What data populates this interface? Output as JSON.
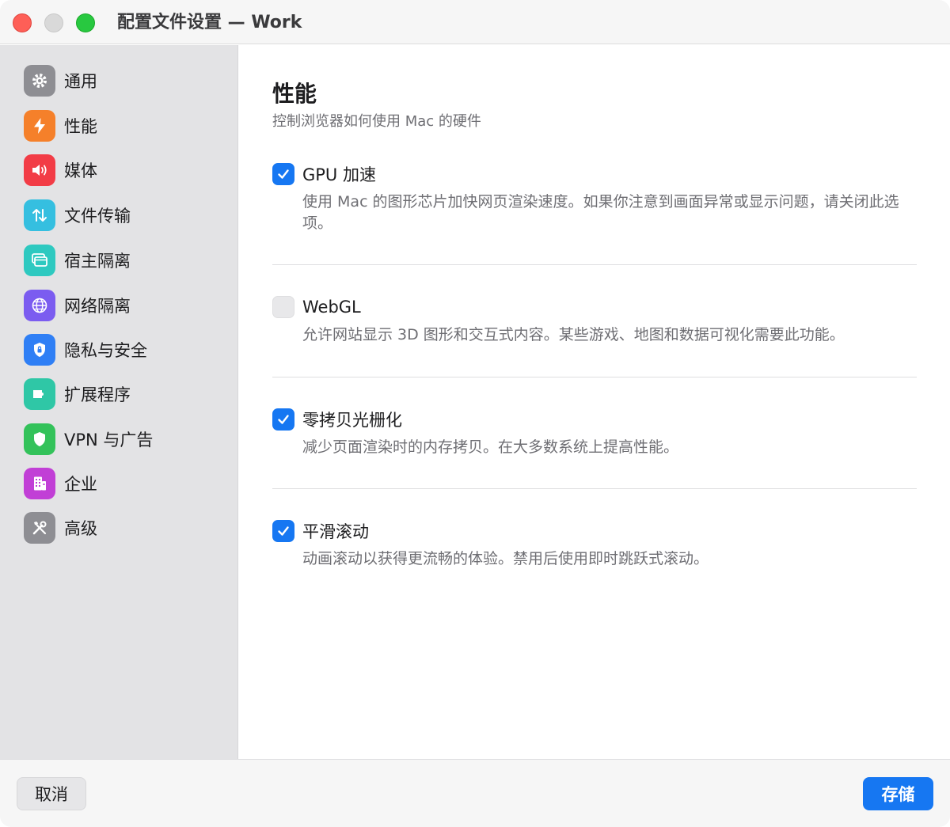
{
  "window": {
    "title": "配置文件设置 — Work"
  },
  "sidebar": {
    "items": [
      {
        "label": "通用",
        "icon": "gear-icon",
        "color": "#8e8e93"
      },
      {
        "label": "性能",
        "icon": "bolt-icon",
        "color": "#f5802a"
      },
      {
        "label": "媒体",
        "icon": "speaker-icon",
        "color": "#f23c46"
      },
      {
        "label": "文件传输",
        "icon": "transfer-arrows-icon",
        "color": "#35bfe0"
      },
      {
        "label": "宿主隔离",
        "icon": "windows-icon",
        "color": "#2ec9c0"
      },
      {
        "label": "网络隔离",
        "icon": "globe-icon",
        "color": "#7b5cf0"
      },
      {
        "label": "隐私与安全",
        "icon": "lock-icon",
        "color": "#2f7ff5"
      },
      {
        "label": "扩展程序",
        "icon": "puzzle-icon",
        "color": "#2fc7a6"
      },
      {
        "label": "VPN 与广告",
        "icon": "shield-icon",
        "color": "#33c25a"
      },
      {
        "label": "企业",
        "icon": "building-icon",
        "color": "#c13fd6"
      },
      {
        "label": "高级",
        "icon": "tools-icon",
        "color": "#8e8e93"
      }
    ]
  },
  "main": {
    "title": "性能",
    "subtitle": "控制浏览器如何使用 Mac 的硬件",
    "options": [
      {
        "label": "GPU 加速",
        "checked": true,
        "description": "使用 Mac 的图形芯片加快网页渲染速度。如果你注意到画面异常或显示问题，请关闭此选项。"
      },
      {
        "label": "WebGL",
        "checked": false,
        "description": "允许网站显示 3D 图形和交互式内容。某些游戏、地图和数据可视化需要此功能。"
      },
      {
        "label": "零拷贝光栅化",
        "checked": true,
        "description": "减少页面渲染时的内存拷贝。在大多数系统上提高性能。"
      },
      {
        "label": "平滑滚动",
        "checked": true,
        "description": "动画滚动以获得更流畅的体验。禁用后使用即时跳跃式滚动。"
      }
    ]
  },
  "footer": {
    "cancel_label": "取消",
    "save_label": "存储"
  },
  "colors": {
    "accent": "#1677f2",
    "sidebar_bg": "#e3e3e5"
  }
}
